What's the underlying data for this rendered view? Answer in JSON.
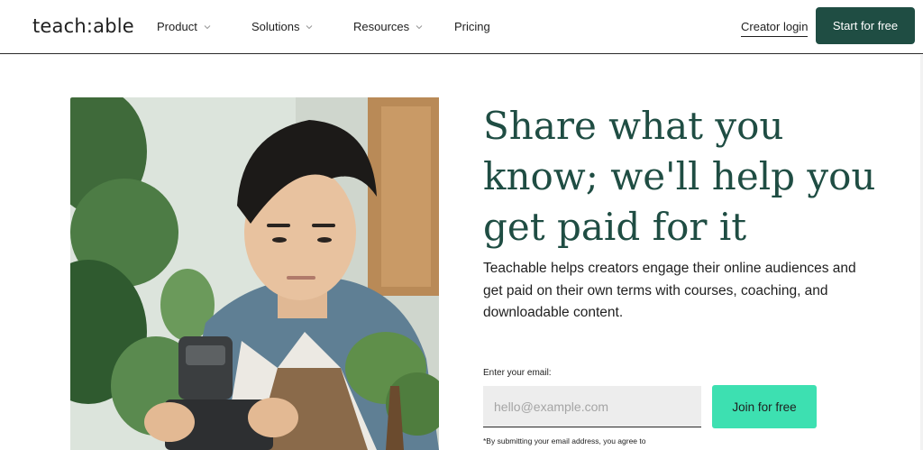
{
  "header": {
    "logo": "teach:able",
    "nav": {
      "product": "Product",
      "solutions": "Solutions",
      "resources": "Resources",
      "pricing": "Pricing"
    },
    "creator_login": "Creator login",
    "start_button": "Start for free"
  },
  "hero": {
    "headline": "Share what you know; we'll help you get paid for it",
    "subtext": "Teachable helps creators engage their online audiences and get paid on their own terms with courses, coaching, and downloadable content.",
    "email_label": "Enter your email:",
    "email_placeholder": "hello@example.com",
    "join_button": "Join for free",
    "disclaimer": "*By submitting your email address, you agree to"
  },
  "colors": {
    "brand_dark_green": "#1f4d43",
    "accent_mint": "#3de0b1",
    "input_bg": "#ededed"
  },
  "icons": {
    "dropdown": "chevron-down-icon"
  }
}
